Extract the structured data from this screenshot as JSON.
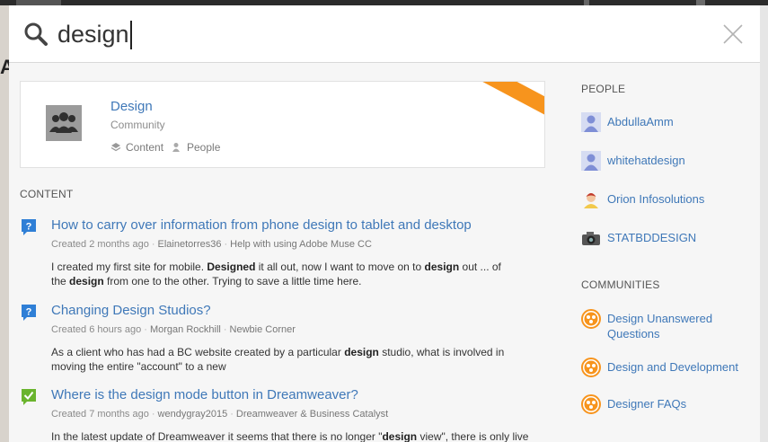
{
  "search": {
    "query": "design",
    "placeholder": ""
  },
  "community_card": {
    "title": "Design",
    "type": "Community",
    "content_link": "Content",
    "people_link": "People"
  },
  "content": {
    "heading": "CONTENT",
    "results": [
      {
        "icon": "question-icon",
        "title": "How to carry over information from phone design to tablet and desktop",
        "meta": [
          "Created 2 months ago",
          "Elainetorres36",
          "Help with using Adobe Muse CC"
        ],
        "snippet_parts": [
          "I created my first site for mobile. ",
          "Designed",
          " it all out, now I want to move on to ",
          "design",
          " out ... of the ",
          "design",
          " from one to the other. Trying to save a little time here."
        ]
      },
      {
        "icon": "question-icon",
        "title": "Changing Design Studios?",
        "meta": [
          "Created 6 hours ago",
          "Morgan Rockhill",
          "Newbie Corner"
        ],
        "snippet_parts": [
          "As a client who has had a BC website created by a particular ",
          "design",
          " studio, what is involved in moving the entire \"account\" to a new"
        ]
      },
      {
        "icon": "answered-check-icon",
        "title": "Where is the design mode button in Dreamweaver?",
        "meta": [
          "Created 7 months ago",
          "wendygray2015",
          "Dreamweaver & Business Catalyst"
        ],
        "snippet_parts": [
          "In the latest update of Dreamweaver it seems that there is no longer \"",
          "design",
          " view\", there is only live"
        ]
      }
    ]
  },
  "people": {
    "heading": "PEOPLE",
    "items": [
      {
        "name": "AbdullaAmm",
        "icon": "default-user-avatar-icon"
      },
      {
        "name": "whitehatdesign",
        "icon": "default-user-avatar-icon"
      },
      {
        "name": "Orion Infosolutions",
        "icon": "cartoon-avatar-icon"
      },
      {
        "name": "STATBDDESIGN",
        "icon": "camera-avatar-icon"
      }
    ]
  },
  "communities": {
    "heading": "COMMUNITIES",
    "items": [
      {
        "name": "Design Unanswered Questions",
        "icon": "community-icon"
      },
      {
        "name": "Design and Development",
        "icon": "community-icon"
      },
      {
        "name": "Designer FAQs",
        "icon": "community-icon"
      }
    ]
  },
  "colors": {
    "link_blue": "#3f78b8",
    "accent_orange": "#f7941d",
    "question_blue": "#2f7fd6",
    "answered_green": "#6ab42d"
  }
}
